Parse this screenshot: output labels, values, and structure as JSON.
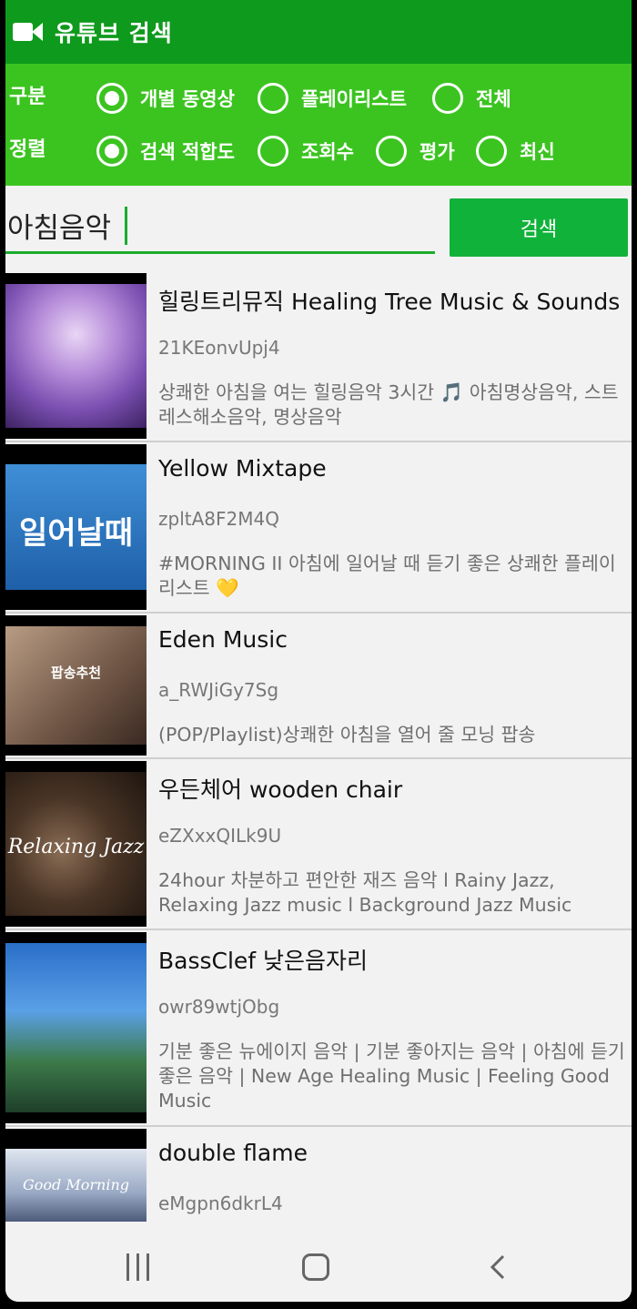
{
  "app": {
    "title": "유튜브 검색",
    "icon": "video-camera-icon"
  },
  "filters": {
    "type_label": "구분",
    "type_options": [
      "개별 동영상",
      "플레이리스트",
      "전체"
    ],
    "type_selected": "개별 동영상",
    "sort_label": "정렬",
    "sort_options": [
      "검색 적합도",
      "조회수",
      "평가",
      "최신"
    ],
    "sort_selected": "검색 적합도"
  },
  "search": {
    "value": "아침음악",
    "button_label": "검색"
  },
  "results": [
    {
      "channel": "힐링트리뮤직 Healing Tree Music & Sounds",
      "video_id": "21KEonvUpj4",
      "description": "상쾌한 아침을 여는 힐링음악 3시간 🎵 아침명상음악, 스트레스해소음악, 명상음악"
    },
    {
      "channel": "Yellow Mixtape",
      "video_id": "zpltA8F2M4Q",
      "description": "#MORNING II 아침에 일어날 때 듣기 좋은 상쾌한 플레이리스트 💛",
      "thumb_text": "일어날때"
    },
    {
      "channel": "Eden Music",
      "video_id": "a_RWJiGy7Sg",
      "description": "(POP/Playlist)상쾌한 아침을 열어 줄 모닝 팝송",
      "thumb_text": "팝송추천"
    },
    {
      "channel": "우든체어 wooden chair",
      "video_id": "eZXxxQILk9U",
      "description": "24hour 차분하고 편안한 재즈 음악 l Rainy Jazz, Relaxing Jazz music l Background Jazz Music",
      "thumb_text": "Relaxing Jazz"
    },
    {
      "channel": "BassClef 낮은음자리",
      "video_id": "owr89wtjObg",
      "description": "기분 좋은 뉴에이지 음악 | 기분 좋아지는 음악 | 아침에 듣기 좋은 음악 | New Age Healing Music | Feeling Good Music"
    },
    {
      "channel": "double flame",
      "video_id": "eMgpn6dkrL4",
      "description": "",
      "thumb_text": "Good Morning"
    }
  ],
  "colors": {
    "appbar": "#0e9a1c",
    "filters": "#3bc420",
    "accent": "#11b23a"
  }
}
